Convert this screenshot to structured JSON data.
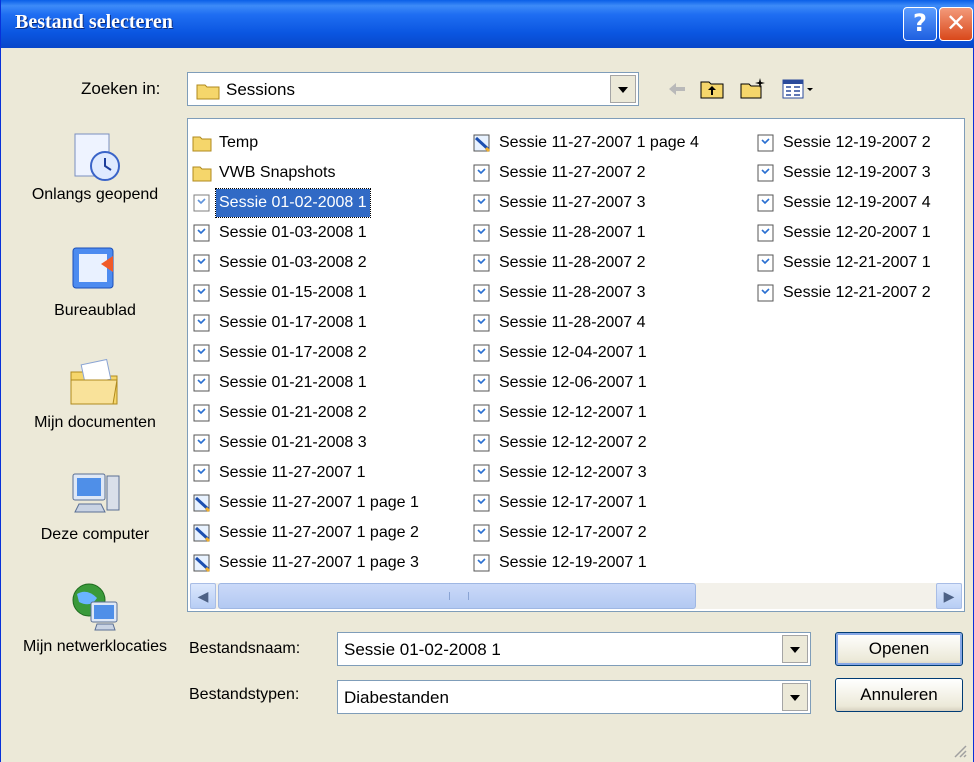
{
  "dialog": {
    "title": "Bestand selecteren"
  },
  "titlebar": {
    "help": "?",
    "close": "✕"
  },
  "look_in": {
    "label": "Zoeken in:",
    "value": "Sessions"
  },
  "places": [
    {
      "label": "Onlangs geopend",
      "icon": "recent-icon"
    },
    {
      "label": "Bureaublad",
      "icon": "desktop-icon"
    },
    {
      "label": "Mijn documenten",
      "icon": "my-documents-icon"
    },
    {
      "label": "Deze computer",
      "icon": "my-computer-icon"
    },
    {
      "label": "Mijn netwerklocaties",
      "icon": "network-icon"
    }
  ],
  "files": {
    "col1": [
      {
        "name": "Temp",
        "type": "folder"
      },
      {
        "name": "VWB Snapshots",
        "type": "folder"
      },
      {
        "name": "Sessie 01-02-2008 1",
        "type": "session",
        "selected": true
      },
      {
        "name": "Sessie 01-03-2008 1",
        "type": "session"
      },
      {
        "name": "Sessie 01-03-2008 2",
        "type": "session"
      },
      {
        "name": "Sessie 01-15-2008 1",
        "type": "session"
      },
      {
        "name": "Sessie 01-17-2008 1",
        "type": "session"
      },
      {
        "name": "Sessie 01-17-2008 2",
        "type": "session"
      },
      {
        "name": "Sessie 01-21-2008 1",
        "type": "session"
      },
      {
        "name": "Sessie 01-21-2008 2",
        "type": "session"
      },
      {
        "name": "Sessie 01-21-2008 3",
        "type": "session"
      },
      {
        "name": "Sessie 11-27-2007 1",
        "type": "session"
      },
      {
        "name": "Sessie 11-27-2007 1 page 1",
        "type": "page"
      },
      {
        "name": "Sessie 11-27-2007 1 page 2",
        "type": "page"
      },
      {
        "name": "Sessie 11-27-2007 1 page 3",
        "type": "page"
      }
    ],
    "col2": [
      {
        "name": "Sessie 11-27-2007 1 page 4",
        "type": "page"
      },
      {
        "name": "Sessie 11-27-2007 2",
        "type": "session"
      },
      {
        "name": "Sessie 11-27-2007 3",
        "type": "session"
      },
      {
        "name": "Sessie 11-28-2007 1",
        "type": "session"
      },
      {
        "name": "Sessie 11-28-2007 2",
        "type": "session"
      },
      {
        "name": "Sessie 11-28-2007 3",
        "type": "session"
      },
      {
        "name": "Sessie 11-28-2007 4",
        "type": "session"
      },
      {
        "name": "Sessie 12-04-2007 1",
        "type": "session"
      },
      {
        "name": "Sessie 12-06-2007 1",
        "type": "session"
      },
      {
        "name": "Sessie 12-12-2007 1",
        "type": "session"
      },
      {
        "name": "Sessie 12-12-2007 2",
        "type": "session"
      },
      {
        "name": "Sessie 12-12-2007 3",
        "type": "session"
      },
      {
        "name": "Sessie 12-17-2007 1",
        "type": "session"
      },
      {
        "name": "Sessie 12-17-2007 2",
        "type": "session"
      },
      {
        "name": "Sessie 12-19-2007 1",
        "type": "session"
      }
    ],
    "col3": [
      {
        "name": "Sessie 12-19-2007 2",
        "type": "session"
      },
      {
        "name": "Sessie 12-19-2007 3",
        "type": "session"
      },
      {
        "name": "Sessie 12-19-2007 4",
        "type": "session"
      },
      {
        "name": "Sessie 12-20-2007 1",
        "type": "session"
      },
      {
        "name": "Sessie 12-21-2007 1",
        "type": "session"
      },
      {
        "name": "Sessie 12-21-2007 2",
        "type": "session"
      }
    ]
  },
  "filename": {
    "label": "Bestandsnaam:",
    "value": "Sessie 01-02-2008 1"
  },
  "filetype": {
    "label": "Bestandstypen:",
    "value": "Diabestanden"
  },
  "buttons": {
    "open": "Openen",
    "cancel": "Annuleren"
  },
  "colors": {
    "titlebar": "#0a55e0",
    "selection": "#316ac5",
    "face": "#ece9d8"
  }
}
